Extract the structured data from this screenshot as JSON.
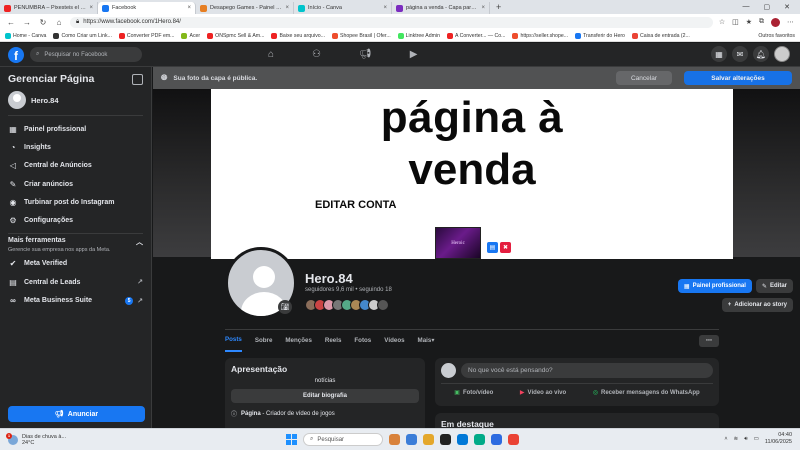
{
  "browser": {
    "tabs": [
      {
        "label": "PENUMBRA – Pixesteis el vi...",
        "color": "#e22"
      },
      {
        "label": "Facebook",
        "color": "#1877f2",
        "active": true
      },
      {
        "label": "Desapego Games - Painel + Cont...",
        "color": "#e67e22"
      },
      {
        "label": "Início - Canva",
        "color": "#00c4cc"
      },
      {
        "label": "página a venda - Capa para Faceb...",
        "color": "#7b2cbf"
      }
    ],
    "url": "https://www.facebook.com/1Hero.84/",
    "bookmarks": [
      {
        "label": "Home - Canva",
        "color": "#00c4cc"
      },
      {
        "label": "Como Criar um Link...",
        "color": "#333"
      },
      {
        "label": "Converter PDF em...",
        "color": "#e22"
      },
      {
        "label": "Acer",
        "color": "#83b81a"
      },
      {
        "label": "ONSpmc Sell & Am...",
        "color": "#e22"
      },
      {
        "label": "Baixe seu arquivo...",
        "color": "#e22"
      },
      {
        "label": "Shopee Brasil | Ofer...",
        "color": "#ee4d2d"
      },
      {
        "label": "Linktree Admin",
        "color": "#43e660"
      },
      {
        "label": "A Converter... — Co...",
        "color": "#e22"
      },
      {
        "label": "https://seller.shope...",
        "color": "#ee4d2d"
      },
      {
        "label": "Transferir do Hero",
        "color": "#1877f2"
      },
      {
        "label": "Caixa de entrada (2...",
        "color": "#ea4335"
      }
    ],
    "bookmarks_other": "Outros favoritos"
  },
  "fb": {
    "search_placeholder": "Pesquisar no Facebook"
  },
  "sidebar": {
    "title": "Gerenciar Página",
    "page_name": "Hero.84",
    "items": [
      {
        "label": "Painel profissional",
        "icon": "▦"
      },
      {
        "label": "Insights",
        "icon": "◔"
      },
      {
        "label": "Central de Anúncios",
        "icon": "◁"
      },
      {
        "label": "Criar anúncios",
        "icon": "✎"
      },
      {
        "label": "Turbinar post do Instagram",
        "icon": "◉"
      },
      {
        "label": "Configurações",
        "icon": "⚙"
      }
    ],
    "more_tools_title": "Mais ferramentas",
    "more_tools_sub": "Gerencie sua empresa nos apps da Meta.",
    "tools": [
      {
        "label": "Meta Verified",
        "icon": "✔"
      },
      {
        "label": "Central de Leads",
        "icon": "▤",
        "arrow": "↗"
      },
      {
        "label": "Meta Business Suite",
        "icon": "∞",
        "badge": "5",
        "arrow": "↗"
      }
    ],
    "ad_button": "Anunciar"
  },
  "cover": {
    "notice": "Sua foto da capa é pública.",
    "cancel": "Cancelar",
    "save": "Salvar alterações",
    "line1": "página à",
    "line2": "venda",
    "line3": "EDITAR CONTA",
    "thumb_text": "Heroic"
  },
  "profile": {
    "name": "Hero.84",
    "stats": "seguidores 9,6 mil • seguindo 18",
    "friend_colors": [
      "#8a6d5a",
      "#c44",
      "#d9a",
      "#777",
      "#5a8",
      "#a85",
      "#48c",
      "#ccc",
      "#555"
    ],
    "btn_dashboard": "Painel profissional",
    "btn_edit": "Editar",
    "btn_story": "Adicionar ao story"
  },
  "tabs": [
    "Posts",
    "Sobre",
    "Menções",
    "Reels",
    "Fotos",
    "Vídeos",
    "Mais"
  ],
  "intro": {
    "title": "Apresentação",
    "bio": "notícias",
    "edit_bio": "Editar biografia",
    "category_label": "Página",
    "category": " - Criador de vídeo de jogos"
  },
  "composer": {
    "placeholder": "No que você está pensando?",
    "photo": "Foto/vídeo",
    "live": "Vídeo ao vivo",
    "whatsapp": "Receber mensagens do WhatsApp"
  },
  "featured_title": "Em destaque",
  "taskbar": {
    "weather_line1": "Dias de chuva à...",
    "weather_line2": "24°C",
    "weather_badge": "1",
    "search": "Pesquisar",
    "time": "04:40",
    "date": "11/06/2025",
    "app_colors": [
      "#d9823b",
      "#3b7dd8",
      "#e4a72b",
      "#222",
      "#0078d7",
      "#0a8",
      "#2d6be0",
      "#ea4335"
    ]
  }
}
